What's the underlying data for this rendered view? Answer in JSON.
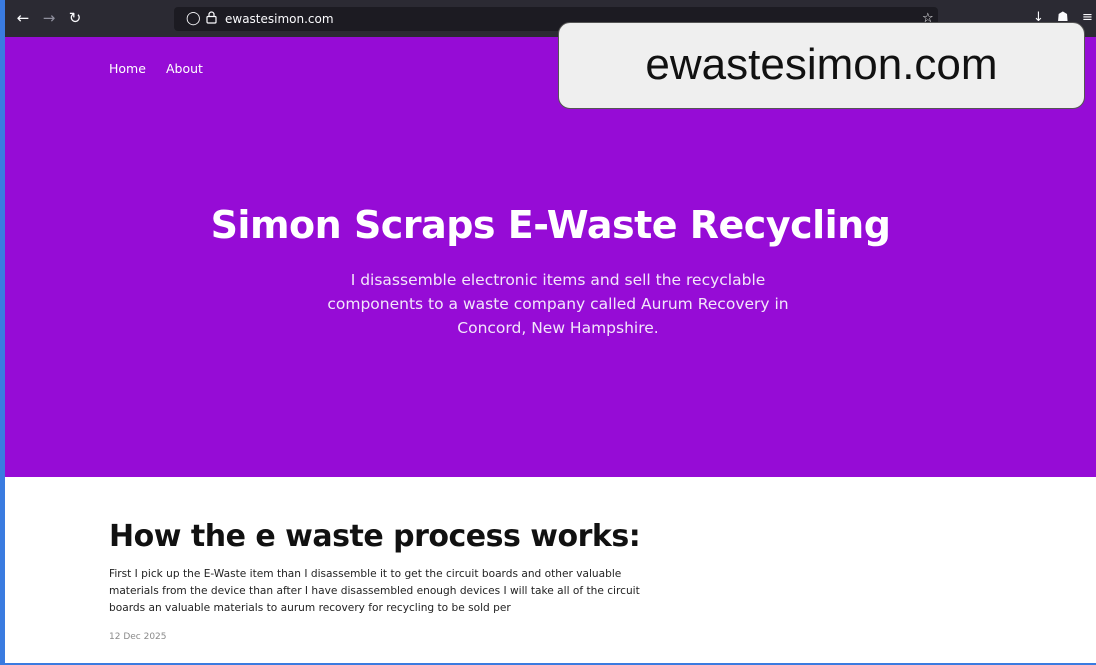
{
  "browser": {
    "url": "ewastesimon.com",
    "icons": {
      "back": "back-arrow-icon",
      "forward": "forward-arrow-icon",
      "reload": "reload-icon",
      "tracking": "shield-icon",
      "lock": "lock-icon",
      "bookmark": "star-icon",
      "downloads": "download-icon",
      "extensions": "puzzle-icon",
      "menu": "hamburger-menu-icon"
    }
  },
  "site": {
    "nav": [
      "Home",
      "About"
    ],
    "hero_title": "Simon Scraps E-Waste Recycling",
    "hero_subtitle": "I disassemble electronic items and sell the recyclable components to a waste company called Aurum Recovery in Concord, New Hampshire.",
    "accent_color": "#960cd6"
  },
  "post": {
    "title": "How the e waste process works:",
    "body": "First I pick up the E-Waste item than I disassemble it to get the circuit boards and other valuable materials from the device than after I have disassembled enough devices I will take all of the circuit boards an valuable materials to aurum recovery for recycling to be sold per",
    "date": "12 Dec 2025"
  },
  "overlay_label": "ewastesimon.com"
}
